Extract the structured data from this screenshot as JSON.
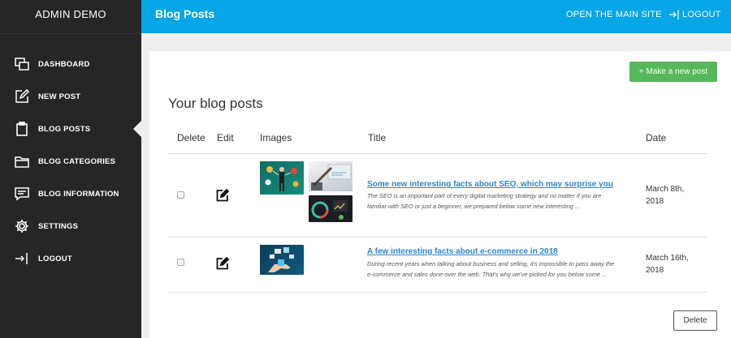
{
  "app": {
    "brand": "ADMIN DEMO",
    "page_title": "Blog Posts"
  },
  "sidebar": {
    "items": [
      {
        "label": "DASHBOARD",
        "icon": "dashboard-icon"
      },
      {
        "label": "NEW POST",
        "icon": "edit-icon"
      },
      {
        "label": "BLOG POSTS",
        "icon": "clipboard-icon",
        "active": true
      },
      {
        "label": "BLOG CATEGORIES",
        "icon": "folder-icon"
      },
      {
        "label": "BLOG INFORMATION",
        "icon": "chat-icon"
      },
      {
        "label": "SETTINGS",
        "icon": "gear-icon"
      },
      {
        "label": "LOGOUT",
        "icon": "logout-icon"
      }
    ]
  },
  "topbar": {
    "main_site_label": "OPEN THE MAIN SITE",
    "logout_label": "LOGOUT"
  },
  "main": {
    "new_post_label": "+ Make a new post",
    "section_title": "Your blog posts",
    "columns": [
      "Delete",
      "Edit",
      "Images",
      "Title",
      "Date"
    ],
    "rows": [
      {
        "title": "Some new interesting facts about SEO, which may surprise you",
        "excerpt": "The SEO is an important part of every digital marketing strategy and no matter if you are familiar with SEO or just a beginner, we prepared below some new interesting ...",
        "date": "March 8th, 2018",
        "images": [
          "seo-illustration",
          "laptop-desk",
          "analytics-charts"
        ]
      },
      {
        "title": "A few interesting facts about e-commerce in 2018",
        "excerpt": "During recent years when talking about business and selling, it's impossible to pass away the e-commerce and sales done over the web. That's why we've picked for you below some ...",
        "date": "March 16th, 2018",
        "images": [
          "ecommerce-hand"
        ]
      }
    ],
    "delete_label": "Delete"
  },
  "colors": {
    "sidebar": "#262626",
    "topbar": "#07a6e6",
    "accent_green": "#56b85a",
    "link": "#2b87d1"
  }
}
